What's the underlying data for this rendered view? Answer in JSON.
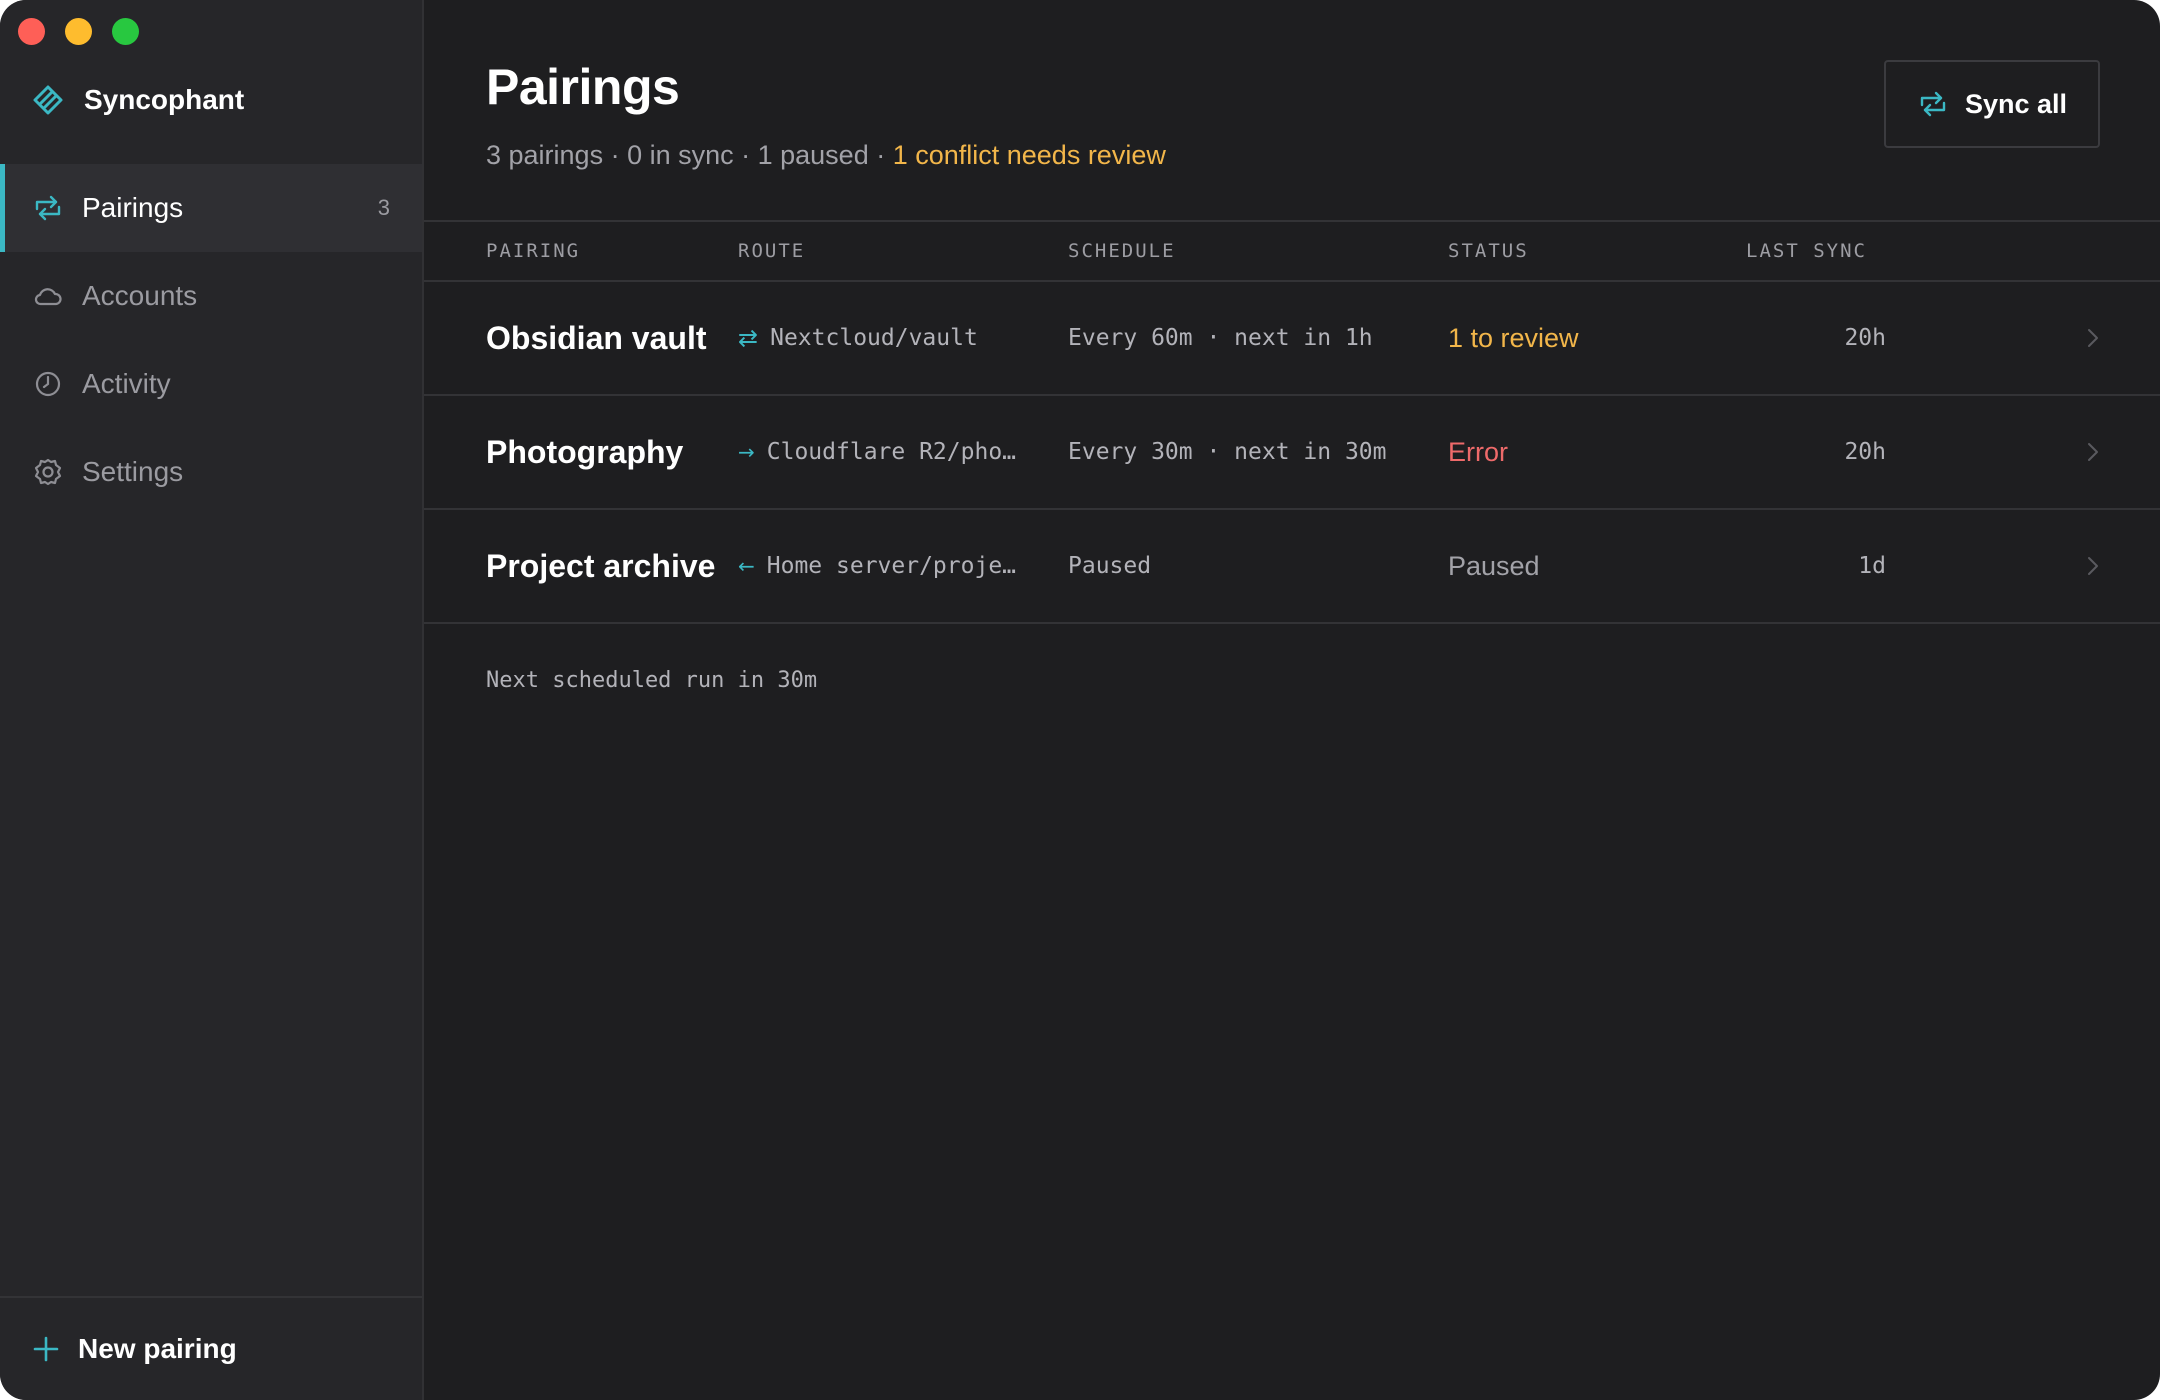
{
  "app": {
    "name": "Syncophant"
  },
  "sidebar": {
    "items": [
      {
        "label": "Pairings",
        "count": "3",
        "icon": "sync-icon",
        "active": true
      },
      {
        "label": "Accounts",
        "icon": "cloud-icon"
      },
      {
        "label": "Activity",
        "icon": "clock-icon"
      },
      {
        "label": "Settings",
        "icon": "gear-icon"
      }
    ],
    "new_pairing_label": "New pairing"
  },
  "header": {
    "title": "Pairings",
    "summary": "3 pairings · 0 in sync · 1 paused · ",
    "summary_warning": "1 conflict needs review",
    "sync_all_label": "Sync all"
  },
  "table": {
    "columns": [
      "PAIRING",
      "ROUTE",
      "SCHEDULE",
      "STATUS",
      "LAST SYNC"
    ],
    "rows": [
      {
        "name": "Obsidian vault",
        "direction": "⇄",
        "direction_type": "two-way",
        "route": "Nextcloud/vault",
        "schedule": "Every 60m · next in 1h",
        "status": "1 to review",
        "status_color": "#f2b64a",
        "last_sync": "20h"
      },
      {
        "name": "Photography",
        "direction": "→",
        "direction_type": "upload",
        "route": "Cloudflare R2/pho…",
        "schedule": "Every 30m · next in 30m",
        "status": "Error",
        "status_color": "#ee6a6a",
        "last_sync": "20h"
      },
      {
        "name": "Project archive",
        "direction": "←",
        "direction_type": "download",
        "route": "Home server/proje…",
        "schedule": "Paused",
        "status": "Paused",
        "status_color": "#a2a2a8",
        "last_sync": "1d"
      }
    ]
  },
  "footer_note": "Next scheduled run in 30m",
  "colors": {
    "accent": "#3bb8c4",
    "warning": "#f2b64a",
    "error": "#ee6a6a",
    "background": "#1e1e20",
    "sidebar": "#262629"
  }
}
